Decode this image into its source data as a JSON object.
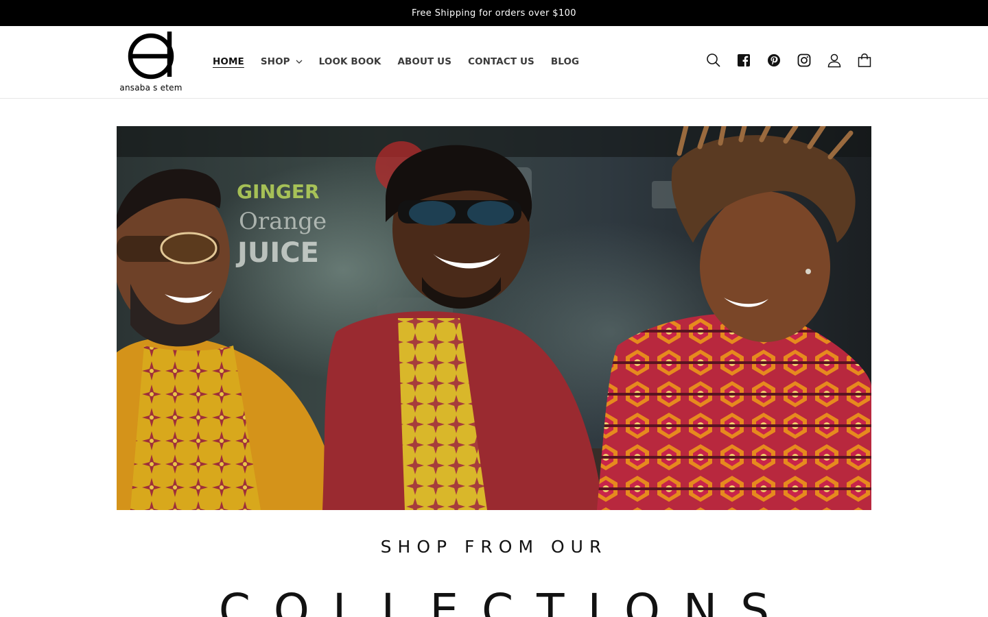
{
  "announcement": {
    "text": "Free Shipping for orders over $100"
  },
  "brand": {
    "name": "ansaba s etem"
  },
  "nav": {
    "items": [
      {
        "label": "HOME",
        "active": true
      },
      {
        "label": "SHOP",
        "has_dropdown": true
      },
      {
        "label": "LOOK BOOK"
      },
      {
        "label": "ABOUT US"
      },
      {
        "label": "CONTACT US"
      },
      {
        "label": "BLOG"
      }
    ]
  },
  "header_icons": [
    "search-icon",
    "facebook-icon",
    "pinterest-icon",
    "instagram-icon",
    "account-icon",
    "cart-icon"
  ],
  "section": {
    "kicker": "SHOP FROM OUR",
    "title": "COLLECTIONS"
  },
  "colors": {
    "announcement_bg": "#000000",
    "text": "#121212",
    "nav_text": "#3a3a3a"
  }
}
